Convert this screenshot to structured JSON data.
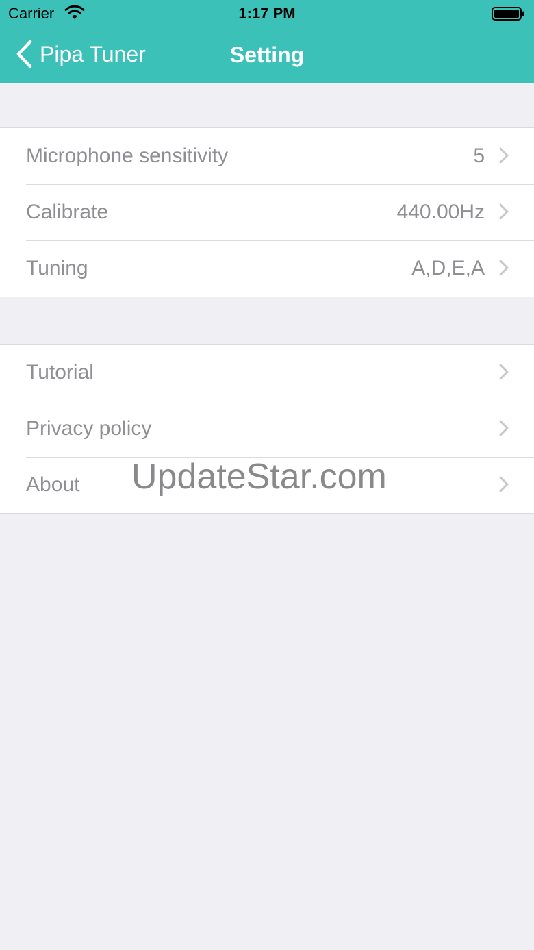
{
  "status_bar": {
    "carrier": "Carrier",
    "time": "1:17 PM",
    "wifi_icon": "wifi-icon",
    "battery_icon": "battery-icon"
  },
  "nav": {
    "back_label": "Pipa Tuner",
    "title": "Setting",
    "back_icon": "chevron-left-icon",
    "bar_color": "#3cc1b9"
  },
  "settings_group_1": [
    {
      "label": "Microphone sensitivity",
      "value": "5"
    },
    {
      "label": "Calibrate",
      "value": "440.00Hz"
    },
    {
      "label": "Tuning",
      "value": "A,D,E,A"
    }
  ],
  "settings_group_2": [
    {
      "label": "Tutorial"
    },
    {
      "label": "Privacy policy"
    },
    {
      "label": "About"
    }
  ],
  "watermark": {
    "text": "UpdateStar.com"
  },
  "colors": {
    "background": "#efeff4",
    "row_text": "#8e8e93"
  }
}
